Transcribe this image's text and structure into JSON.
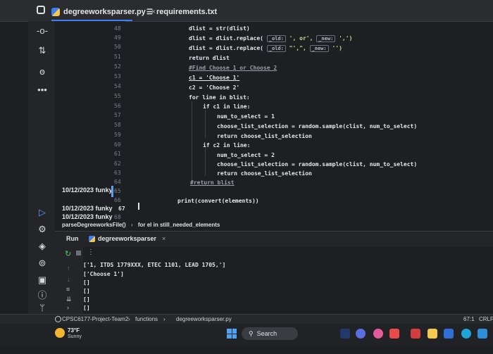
{
  "tabs": [
    {
      "label": "degreeworksparser.py",
      "close": "×"
    },
    {
      "label": "requirements.txt"
    }
  ],
  "annotations": [
    {
      "text": "10/12/2023 funky"
    },
    {
      "text": "10/12/2023 funky"
    },
    {
      "text": "10/12/2023 funky"
    }
  ],
  "line_numbers": [
    "48",
    "49",
    "50",
    "51",
    "52",
    "53",
    "54",
    "55",
    "56",
    "57",
    "58",
    "59",
    "60",
    "61",
    "62",
    "63",
    "64",
    "65",
    "66",
    "67",
    "68"
  ],
  "code": {
    "l48": "dlist = str(dlist)",
    "l49a": "dlist = dlist.replace( ",
    "l49h1": "_old:",
    "l49b": " ', or', ",
    "l49h2": "_new:",
    "l49c": " ',')",
    "l50a": "dlist = dlist.replace( ",
    "l50h1": "_old:",
    "l50b": " \"',\", ",
    "l50h2": "_new:",
    "l50c": " '')",
    "l51": "return dlist",
    "l52": "#Find Choose 1 or Choose 2",
    "l53": "c1 = 'Choose 1'",
    "l54": "c2 = 'Choose 2'",
    "l55": "for line in blist:",
    "l56": "if c1 in line:",
    "l57": "num_to_select = 1",
    "l58": "choose_list_selection = random.sample(clist, num_to_select)",
    "l59": "return choose_list_selection",
    "l60": "if c2 in line:",
    "l61": "num_to_select = 2",
    "l62": "choose_list_selection = random.sample(clist, num_to_select)",
    "l63": "return choose_list_selection",
    "l64": "#return blist",
    "l66": "print(convert(elements))"
  },
  "breadcrumb": {
    "fn": "parseDegreeworksFile()",
    "sep": "›",
    "loop": "for el in still_needed_elements"
  },
  "run": {
    "label": "Run",
    "config": "degreeworksparser",
    "close": "×"
  },
  "output": [
    "['1, ITDS 1779XXX, ETEC 1101, LEAD 1705,']",
    "['Choose 1']",
    "[]",
    "[]",
    "[]",
    "[]",
    "[]"
  ],
  "status": {
    "project": "CPSC6177-Project-Team2",
    "sep1": "›",
    "folder": "functions",
    "sep2": "›",
    "file": "degreeworksparser.py",
    "position": "67:1",
    "eol": "CRLF"
  },
  "taskbar": {
    "temp": "73°F",
    "weather": "Sunny",
    "search": "Search"
  },
  "colors": {
    "accent": "#3d7df5",
    "editor_bg": "#1d1f22"
  }
}
